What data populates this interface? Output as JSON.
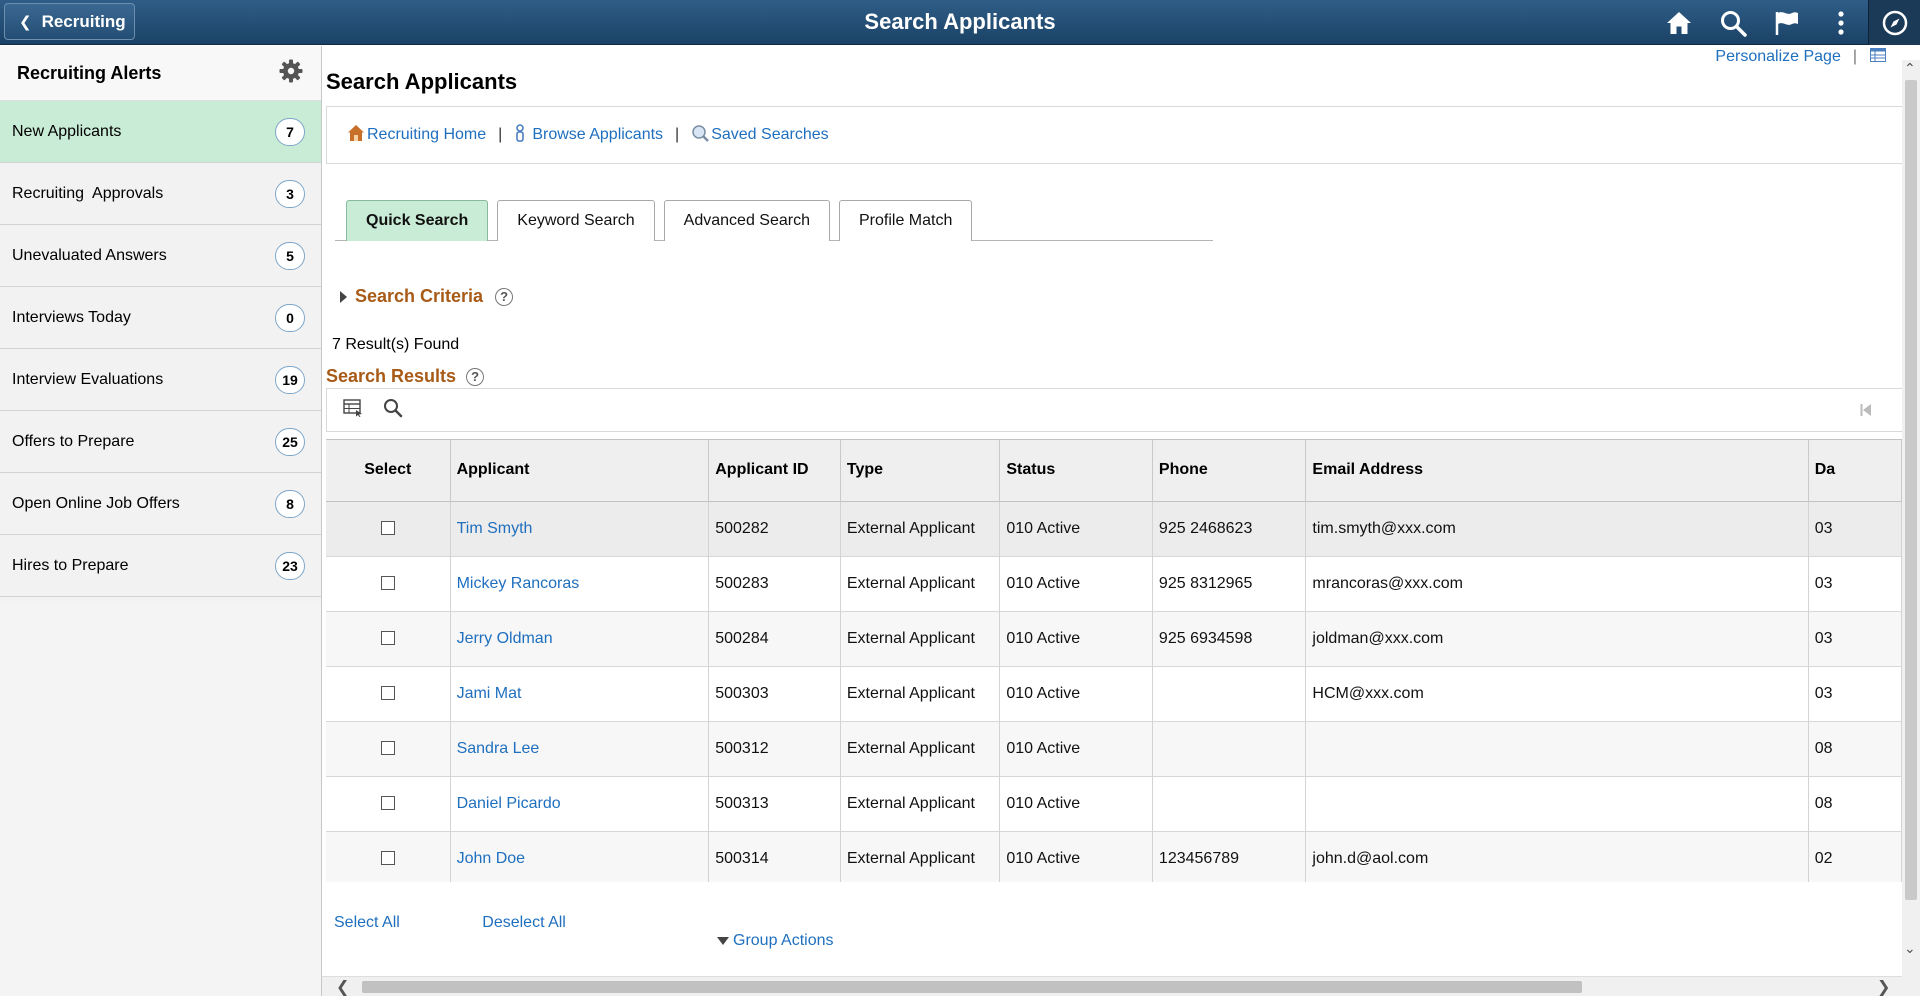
{
  "banner": {
    "back_label": "Recruiting",
    "title": "Search Applicants",
    "icons": [
      "home-icon",
      "search-icon",
      "flag-icon",
      "kebab-menu-icon",
      "navbar-compass-icon"
    ]
  },
  "alerts": {
    "title": "Recruiting Alerts",
    "items": [
      {
        "label": "New Applicants",
        "count": "7"
      },
      {
        "label": "Recruiting  Approvals",
        "count": "3"
      },
      {
        "label": "Unevaluated Answers",
        "count": "5"
      },
      {
        "label": "Interviews Today",
        "count": "0"
      },
      {
        "label": "Interview Evaluations",
        "count": "19"
      },
      {
        "label": "Offers to Prepare",
        "count": "25"
      },
      {
        "label": "Open Online Job Offers",
        "count": "8"
      },
      {
        "label": "Hires to Prepare",
        "count": "23"
      }
    ]
  },
  "main": {
    "personalize": "Personalize Page",
    "personalize_sep": "|",
    "page_title": "Search Applicants",
    "links": {
      "recruiting_home": "Recruiting Home",
      "browse_applicants": "Browse Applicants",
      "saved_searches": "Saved Searches",
      "sep": "|"
    },
    "tabs": [
      "Quick Search",
      "Keyword Search",
      "Advanced Search",
      "Profile Match"
    ],
    "search_criteria": "Search Criteria",
    "help_glyph": "?",
    "results_found": "7 Result(s) Found",
    "search_results": "Search Results",
    "columns": [
      "Select",
      "Applicant",
      "Applicant ID",
      "Type",
      "Status",
      "Phone",
      "Email Address",
      "Da"
    ],
    "rows": [
      {
        "name": "Tim Smyth",
        "id": "500282",
        "type": "External Applicant",
        "status": "010 Active",
        "phone": "925 2468623",
        "email": "tim.smyth@xxx.com",
        "date": "03"
      },
      {
        "name": "Mickey Rancoras",
        "id": "500283",
        "type": "External Applicant",
        "status": "010 Active",
        "phone": "925 8312965",
        "email": "mrancoras@xxx.com",
        "date": "03"
      },
      {
        "name": "Jerry Oldman",
        "id": "500284",
        "type": "External Applicant",
        "status": "010 Active",
        "phone": "925 6934598",
        "email": "joldman@xxx.com",
        "date": "03"
      },
      {
        "name": "Jami Mat",
        "id": "500303",
        "type": "External Applicant",
        "status": "010 Active",
        "phone": "",
        "email": "HCM@xxx.com",
        "date": "03"
      },
      {
        "name": "Sandra Lee",
        "id": "500312",
        "type": "External Applicant",
        "status": "010 Active",
        "phone": "",
        "email": "",
        "date": "08"
      },
      {
        "name": "Daniel Picardo",
        "id": "500313",
        "type": "External Applicant",
        "status": "010 Active",
        "phone": "",
        "email": "",
        "date": "08"
      },
      {
        "name": "John Doe",
        "id": "500314",
        "type": "External Applicant",
        "status": "010 Active",
        "phone": "123456789",
        "email": "john.d@aol.com",
        "date": "02"
      }
    ],
    "select_all": "Select All",
    "deselect_all": "Deselect All",
    "group_actions": "Group Actions"
  },
  "colors": {
    "banner": "#1b4266",
    "active_green": "#c9ecd6",
    "link": "#1f6fbf",
    "section_title": "#a85a17"
  }
}
